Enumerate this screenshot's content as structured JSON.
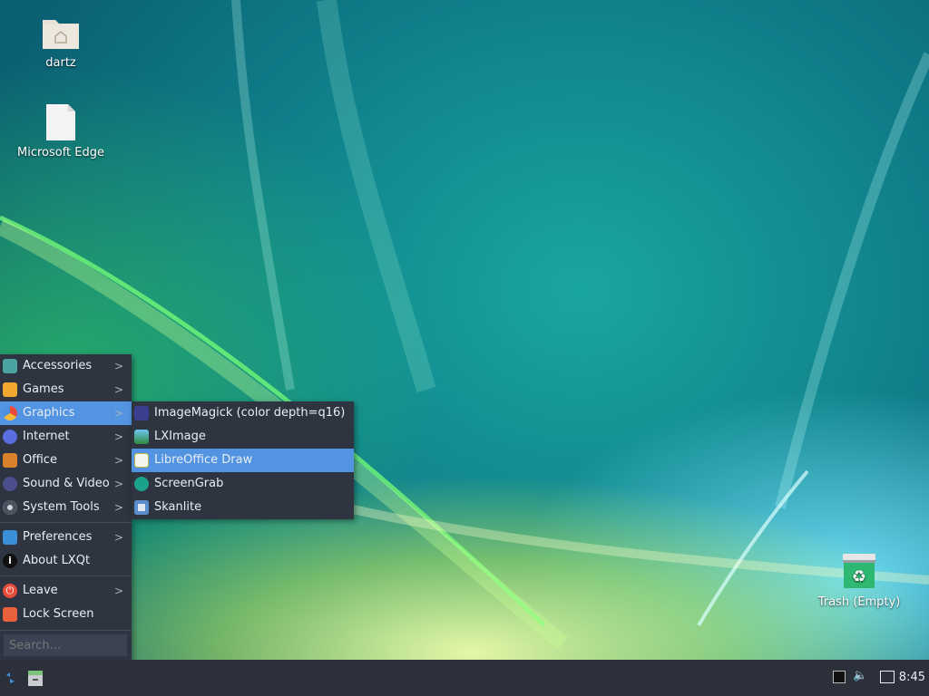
{
  "desktop": {
    "icons": [
      {
        "label": "dartz",
        "icon": "home-folder-icon"
      },
      {
        "label": "Microsoft Edge",
        "icon": "file-icon"
      },
      {
        "label": "Trash (Empty)",
        "icon": "trash-icon"
      }
    ]
  },
  "menu": {
    "items": [
      {
        "label": "Accessories",
        "icon": "accessories-icon",
        "has_submenu": true
      },
      {
        "label": "Games",
        "icon": "games-icon",
        "has_submenu": true
      },
      {
        "label": "Graphics",
        "icon": "graphics-icon",
        "has_submenu": true,
        "active": true
      },
      {
        "label": "Internet",
        "icon": "internet-icon",
        "has_submenu": true
      },
      {
        "label": "Office",
        "icon": "office-icon",
        "has_submenu": true
      },
      {
        "label": "Sound & Video",
        "icon": "sound-video-icon",
        "has_submenu": true
      },
      {
        "label": "System Tools",
        "icon": "system-tools-icon",
        "has_submenu": true
      },
      {
        "label": "Preferences",
        "icon": "preferences-icon",
        "has_submenu": true
      },
      {
        "label": "About LXQt",
        "icon": "info-icon",
        "has_submenu": false
      },
      {
        "label": "Leave",
        "icon": "power-icon",
        "has_submenu": true
      },
      {
        "label": "Lock Screen",
        "icon": "lock-icon",
        "has_submenu": false
      }
    ],
    "search_placeholder": "Search..."
  },
  "submenu": {
    "items": [
      {
        "label": "ImageMagick (color depth=q16)",
        "icon": "imagemagick-icon"
      },
      {
        "label": "LXImage",
        "icon": "lximage-icon"
      },
      {
        "label": "LibreOffice Draw",
        "icon": "libreoffice-draw-icon",
        "active": true
      },
      {
        "label": "ScreenGrab",
        "icon": "screengrab-icon"
      },
      {
        "label": "Skanlite",
        "icon": "skanlite-icon"
      }
    ]
  },
  "taskbar": {
    "clock": "8:45"
  },
  "colors": {
    "menu_bg": "#2e3440",
    "highlight": "#5294e2",
    "taskbar_bg": "#2b303b"
  }
}
